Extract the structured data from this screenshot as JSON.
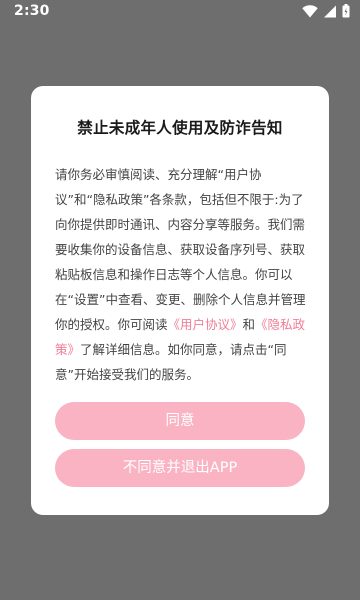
{
  "status_bar": {
    "time": "2:30"
  },
  "dialog": {
    "title": "禁止未成年人使用及防诈告知",
    "body": {
      "paragraph_before_links": "请你务必审慎阅读、充分理解“用户协议”和“隐私政策”各条款，包括但不限于:为了向你提供即时通讯、内容分享等服务。我们需要收集你的设备信息、获取设备序列号、获取粘贴板信息和操作日志等个人信息。你可以在“设置”中查看、变更、删除个人信息并管理你的授权。你可阅读",
      "user_agreement_link": "《用户协议》",
      "and_text": "和",
      "privacy_policy_link": "《隐私政策》",
      "paragraph_after_links": "了解详细信息。如你同意，请点击“同意”开始接受我们的服务。"
    },
    "agree_button": "同意",
    "disagree_button": "不同意并退出APP"
  },
  "colors": {
    "overlay": "#6e6e6e",
    "link": "#f07d96",
    "button": "#f9b3c2"
  },
  "icons": [
    "wifi-icon",
    "signal-icon",
    "battery-icon"
  ]
}
